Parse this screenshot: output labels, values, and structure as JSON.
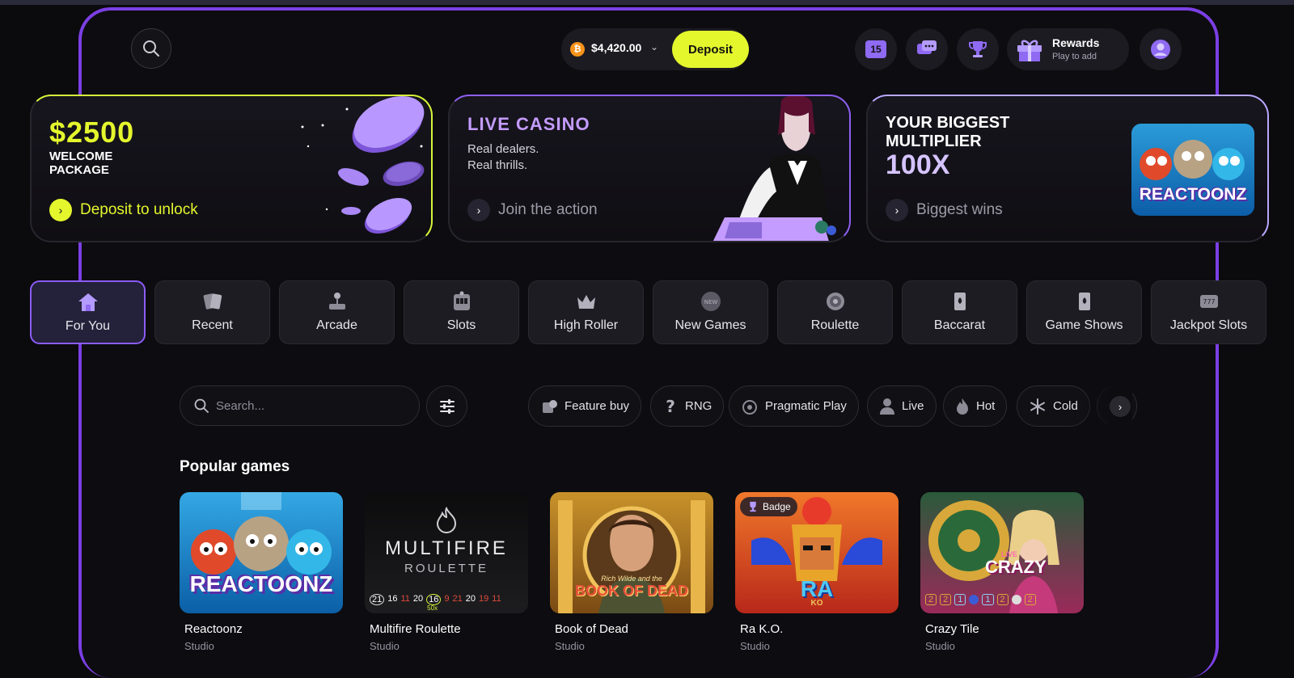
{
  "header": {
    "balance": "$4,420.00",
    "currency_symbol": "₿",
    "deposit_label": "Deposit",
    "calendar_badge": "15",
    "rewards_title": "Rewards",
    "rewards_subtitle": "Play to add"
  },
  "banners": [
    {
      "title": "$2500",
      "subtitle": "WELCOME PACKAGE",
      "cta": "Deposit to unlock"
    },
    {
      "title": "LIVE CASINO",
      "line1": "Real dealers.",
      "line2": "Real thrills.",
      "cta": "Join the action"
    },
    {
      "title": "YOUR BIGGEST MULTIPLIER",
      "highlight": "100X",
      "cta": "Biggest wins",
      "art_label": "REACTOONZ"
    }
  ],
  "categories": [
    {
      "label": "For You",
      "icon": "home-icon",
      "active": true
    },
    {
      "label": "Recent",
      "icon": "cards-icon"
    },
    {
      "label": "Arcade",
      "icon": "joystick-icon"
    },
    {
      "label": "Slots",
      "icon": "slot-machine-icon"
    },
    {
      "label": "High Roller",
      "icon": "crown-icon"
    },
    {
      "label": "New Games",
      "icon": "new-badge-icon"
    },
    {
      "label": "Roulette",
      "icon": "roulette-icon"
    },
    {
      "label": "Baccarat",
      "icon": "card-icon"
    },
    {
      "label": "Game Shows",
      "icon": "card-icon"
    },
    {
      "label": "Jackpot Slots",
      "icon": "jackpot-icon"
    }
  ],
  "search": {
    "placeholder": "Search..."
  },
  "filters": [
    {
      "label": "Feature buy",
      "icon": "feature-buy-icon"
    },
    {
      "label": "RNG",
      "icon": "question-icon"
    },
    {
      "label": "Pragmatic Play",
      "icon": "pragmatic-play-icon"
    },
    {
      "label": "Live",
      "icon": "person-icon"
    },
    {
      "label": "Hot",
      "icon": "flame-icon"
    },
    {
      "label": "Cold",
      "icon": "snowflake-icon"
    }
  ],
  "popular": {
    "title": "Popular games",
    "games": [
      {
        "name": "Reactoonz",
        "studio": "Studio",
        "art_text": "REACTOONZ"
      },
      {
        "name": "Multifire Roulette",
        "studio": "Studio",
        "art_text": "MULTIFIRE",
        "art_sub": "ROULETTE",
        "numbers": [
          "21",
          "16",
          "11",
          "20",
          "16",
          "9",
          "21",
          "20",
          "19",
          "11"
        ],
        "multiplier": "50x"
      },
      {
        "name": "Book of Dead",
        "studio": "Studio",
        "art_text": "BOOK OF DEAD",
        "art_sub": "Rich Wilde and the"
      },
      {
        "name": "Ra K.O.",
        "studio": "Studio",
        "badge": "Badge",
        "art_text": "RA",
        "art_sub": "KO"
      },
      {
        "name": "Crazy Tile",
        "studio": "Studio",
        "art_text": "CRAZY",
        "art_sub": "LIVE",
        "tiles": [
          "2",
          "2",
          "1",
          "1",
          "2",
          "2"
        ]
      }
    ]
  },
  "colors": {
    "accent_purple": "#7b3fe4",
    "accent_lime": "#e4f72d",
    "bitcoin": "#f7931a"
  }
}
